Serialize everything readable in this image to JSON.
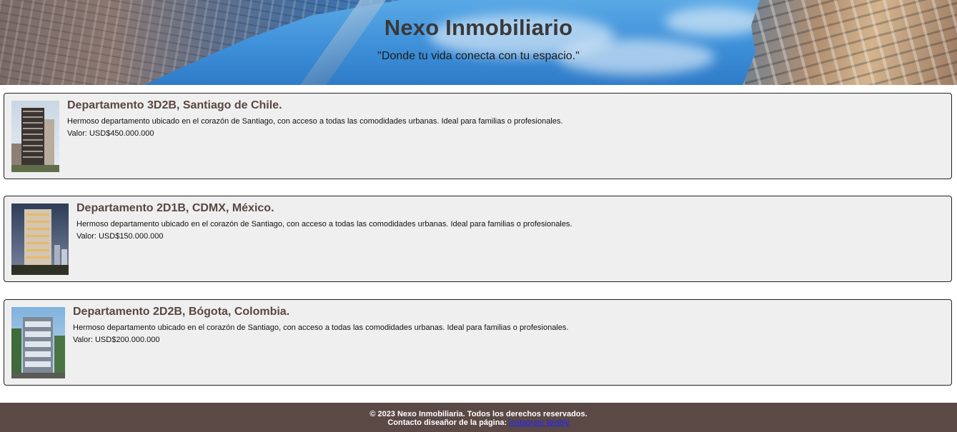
{
  "header": {
    "title": "Nexo Inmobiliario",
    "subtitle": "\"Donde tu vida conecta con tu espacio.\""
  },
  "listings": [
    {
      "title": "Departamento 3D2B, Santiago de Chile.",
      "description": "Hermoso departamento ubicado en el corazón de Santiago, con acceso a todas las comodidades urbanas. Ideal para familias o profesionales.",
      "price": "Valor: USD$450.000.000"
    },
    {
      "title": "Departamento 2D1B, CDMX, México.",
      "description": "Hermoso departamento ubicado en el corazón de Santiago, con acceso a todas las comodidades urbanas. Ideal para familias o profesionales.",
      "price": "Valor: USD$150.000.000"
    },
    {
      "title": "Departamento 2D2B, Bógota, Colombia.",
      "description": "Hermoso departamento ubicado en el corazón de Santiago, con acceso a todas las comodidades urbanas. Ideal para familias o profesionales.",
      "price": "Valor: USD$200.000.000"
    }
  ],
  "footer": {
    "copyright": "© 2023 Nexo Inmobiliaria. Todos los derechos reservados.",
    "contact_label": "Contacto diseañor de la página:",
    "contact_link": "Instagram Wisbly"
  }
}
